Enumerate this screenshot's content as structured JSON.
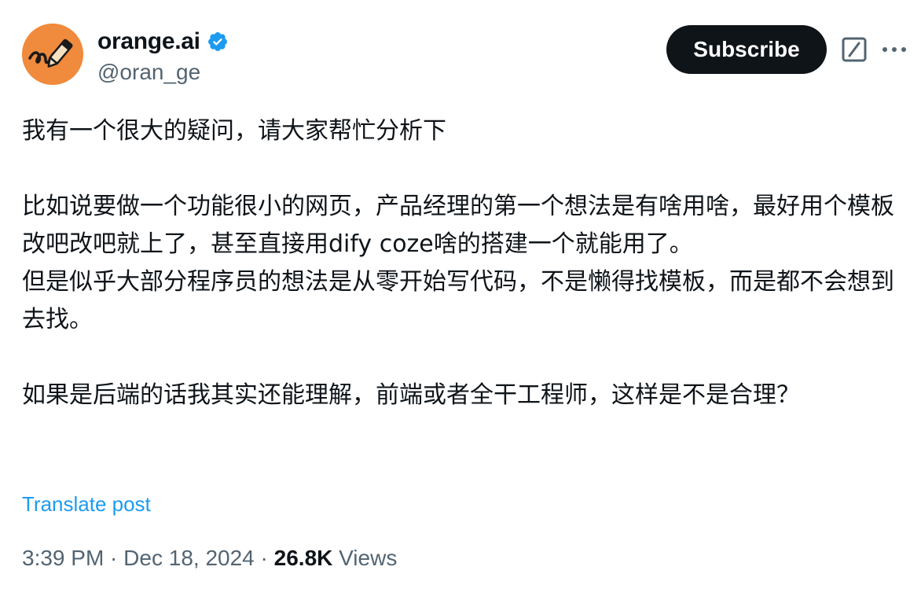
{
  "author": {
    "display_name": "orange.ai",
    "handle": "@oran_ge",
    "avatar_icon": "orange-pen-scribble-avatar",
    "verified_icon": "verified-badge-icon",
    "verified_color": "#1d9bf0",
    "avatar_color": "#f08a3c"
  },
  "actions": {
    "subscribe_label": "Subscribe",
    "grok_icon": "grok-slash-icon",
    "more_icon": "more-dots-icon"
  },
  "tweet": {
    "paragraphs": [
      "我有一个很大的疑问，请大家帮忙分析下",
      "",
      "比如说要做一个功能很小的网页，产品经理的第一个想法是有啥用啥，最好用个模板改吧改吧就上了，甚至直接用dify coze啥的搭建一个就能用了。",
      "但是似乎大部分程序员的想法是从零开始写代码，不是懒得找模板，而是都不会想到去找。",
      "",
      "如果是后端的话我其实还能理解，前端或者全干工程师，这样是不是合理？"
    ],
    "translate_label": "Translate post"
  },
  "meta": {
    "time": "3:39 PM",
    "separator": " · ",
    "date": "Dec 18, 2024",
    "views_count": "26.8K",
    "views_label": " Views"
  }
}
